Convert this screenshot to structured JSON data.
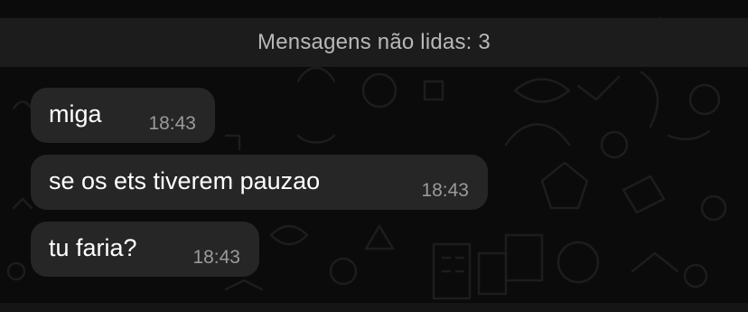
{
  "unread_banner": {
    "text": "Mensagens não lidas: 3"
  },
  "messages": [
    {
      "text": "miga",
      "time": "18:43"
    },
    {
      "text": "se os ets tiverem pauzao",
      "time": "18:43"
    },
    {
      "text": "tu faria?",
      "time": "18:43"
    }
  ],
  "colors": {
    "background": "#0b0b0b",
    "bubble": "#262626",
    "banner": "#1c1c1c",
    "message_text": "#ffffff",
    "time_text": "#9a9a9a"
  }
}
